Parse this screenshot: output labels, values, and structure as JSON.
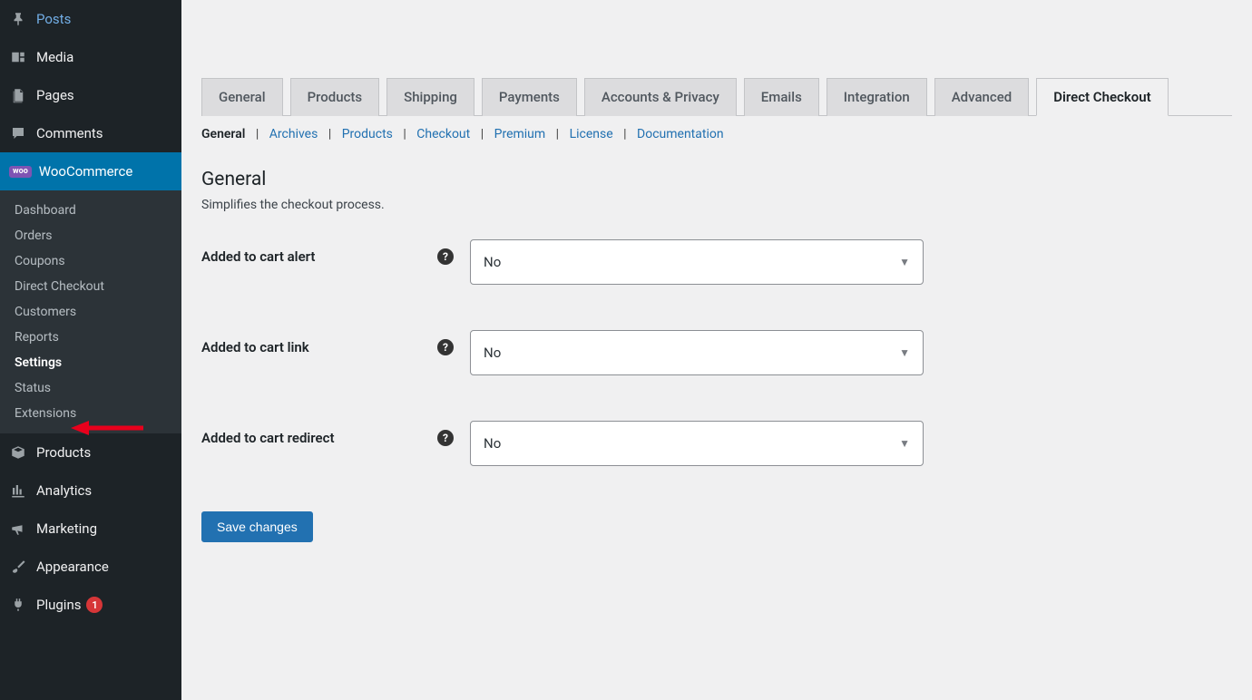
{
  "sidebar": {
    "items": [
      {
        "label": "Posts"
      },
      {
        "label": "Media"
      },
      {
        "label": "Pages"
      },
      {
        "label": "Comments"
      },
      {
        "label": "WooCommerce"
      },
      {
        "label": "Products"
      },
      {
        "label": "Analytics"
      },
      {
        "label": "Marketing"
      },
      {
        "label": "Appearance"
      },
      {
        "label": "Plugins",
        "badge": "1"
      }
    ],
    "submenu": [
      {
        "label": "Dashboard"
      },
      {
        "label": "Orders"
      },
      {
        "label": "Coupons"
      },
      {
        "label": "Direct Checkout"
      },
      {
        "label": "Customers"
      },
      {
        "label": "Reports"
      },
      {
        "label": "Settings"
      },
      {
        "label": "Status"
      },
      {
        "label": "Extensions"
      }
    ]
  },
  "tabs": [
    {
      "label": "General"
    },
    {
      "label": "Products"
    },
    {
      "label": "Shipping"
    },
    {
      "label": "Payments"
    },
    {
      "label": "Accounts & Privacy"
    },
    {
      "label": "Emails"
    },
    {
      "label": "Integration"
    },
    {
      "label": "Advanced"
    },
    {
      "label": "Direct Checkout"
    }
  ],
  "subnav": [
    {
      "label": "General"
    },
    {
      "label": "Archives"
    },
    {
      "label": "Products"
    },
    {
      "label": "Checkout"
    },
    {
      "label": "Premium"
    },
    {
      "label": "License"
    },
    {
      "label": "Documentation"
    }
  ],
  "section": {
    "title": "General",
    "desc": "Simplifies the checkout process."
  },
  "fields": [
    {
      "label": "Added to cart alert",
      "value": "No"
    },
    {
      "label": "Added to cart link",
      "value": "No"
    },
    {
      "label": "Added to cart redirect",
      "value": "No"
    }
  ],
  "actions": {
    "save": "Save changes"
  }
}
